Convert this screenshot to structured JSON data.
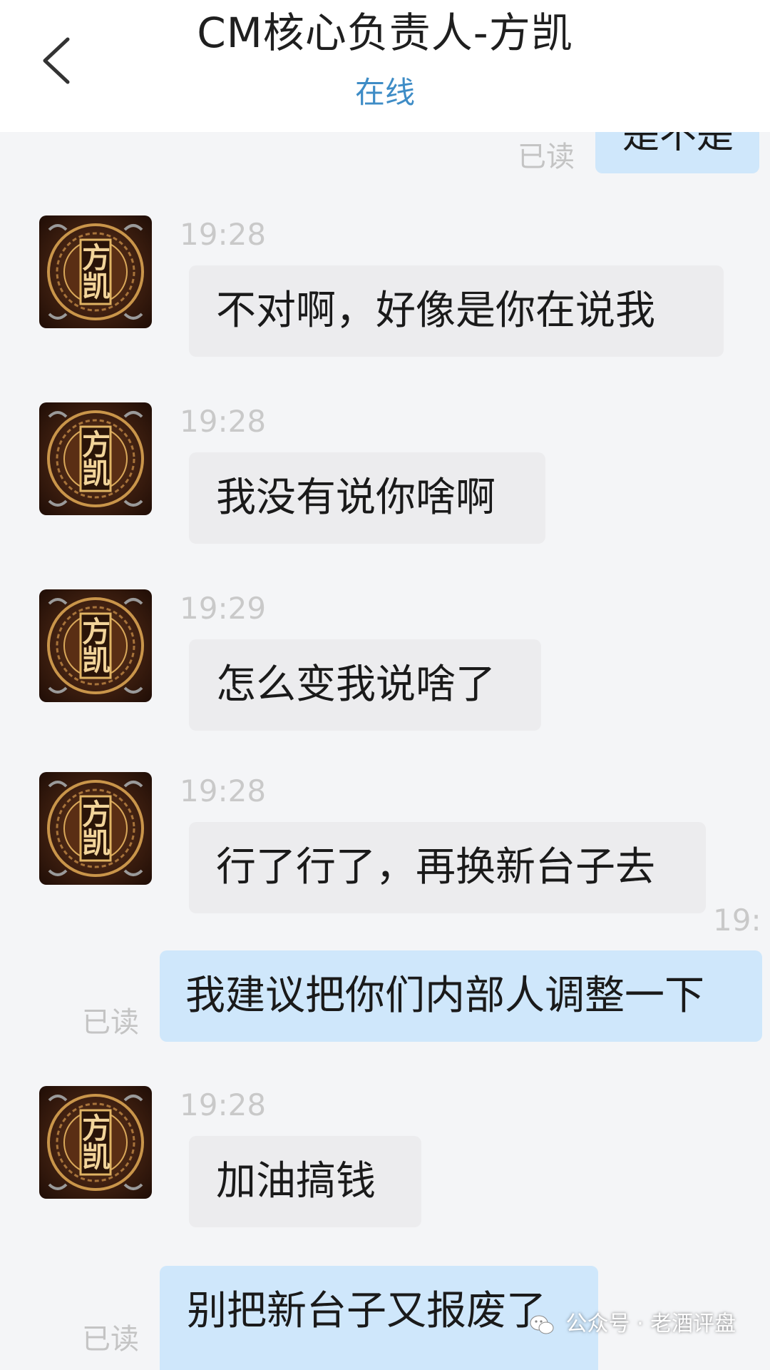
{
  "header": {
    "title": "CM核心负责人-方凯",
    "status": "在线"
  },
  "avatar_char1": "方",
  "avatar_char2": "凯",
  "read_label": "已读",
  "top_partial_text": "是不是",
  "messages": [
    {
      "time": "19:28",
      "text": "不对啊，好像是你在说我"
    },
    {
      "time": "19:28",
      "text": "我没有说你啥啊"
    },
    {
      "time": "19:29",
      "text": "怎么变我说啥了"
    },
    {
      "time": "19:28",
      "text": "行了行了，再换新台子去"
    },
    {
      "time": "19:",
      "text": "我建议把你们内部人调整一下",
      "outgoing": true
    },
    {
      "time": "19:28",
      "text": "加油搞钱"
    },
    {
      "text": "别把新台子又报废了",
      "outgoing": true
    }
  ],
  "watermark": "公众号 · 老酒评盘",
  "colors": {
    "accent": "#3e8cc6",
    "outgoing_bubble": "#cfe7fb",
    "incoming_bubble": "#ececee",
    "background": "#f4f5f7"
  }
}
